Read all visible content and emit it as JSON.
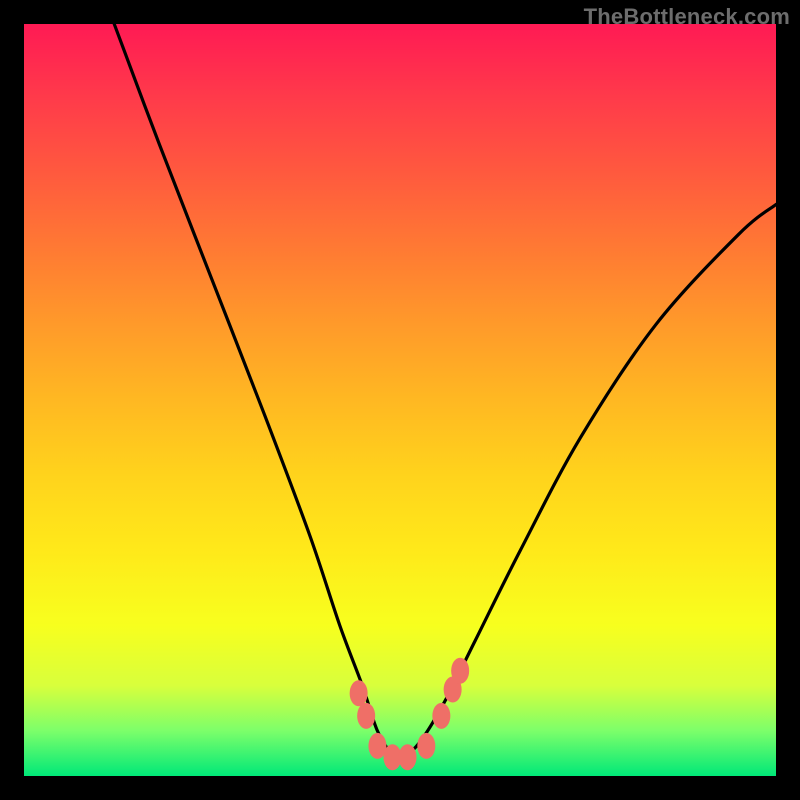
{
  "watermark": "TheBottleneck.com",
  "chart_data": {
    "type": "line",
    "title": "",
    "xlabel": "",
    "ylabel": "",
    "xlim": [
      0,
      100
    ],
    "ylim": [
      0,
      100
    ],
    "series": [
      {
        "name": "curve",
        "x": [
          12,
          18,
          25,
          32,
          38,
          42,
          45,
          47,
          49,
          51,
          53,
          56,
          60,
          66,
          74,
          84,
          95,
          100
        ],
        "y": [
          100,
          84,
          66,
          48,
          32,
          20,
          12,
          6,
          3,
          3,
          5,
          10,
          18,
          30,
          45,
          60,
          72,
          76
        ]
      }
    ],
    "markers": [
      {
        "x": 44.5,
        "y": 11.0
      },
      {
        "x": 45.5,
        "y": 8.0
      },
      {
        "x": 47.0,
        "y": 4.0
      },
      {
        "x": 49.0,
        "y": 2.5
      },
      {
        "x": 51.0,
        "y": 2.5
      },
      {
        "x": 53.5,
        "y": 4.0
      },
      {
        "x": 55.5,
        "y": 8.0
      },
      {
        "x": 57.0,
        "y": 11.5
      },
      {
        "x": 58.0,
        "y": 14.0
      }
    ],
    "marker_color": "#ef6f67",
    "curve_color": "#000000"
  }
}
